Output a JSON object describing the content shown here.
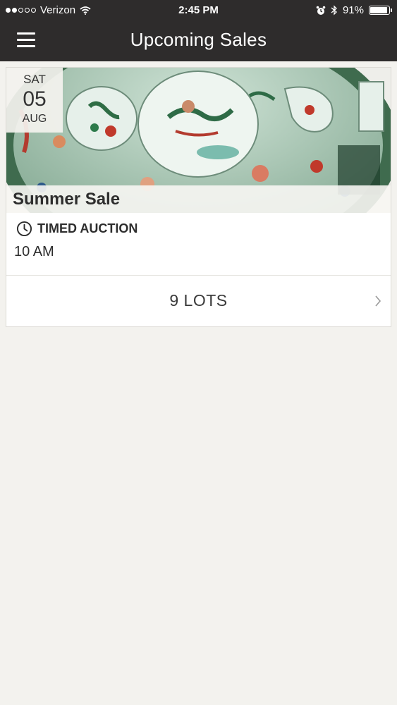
{
  "status": {
    "carrier": "Verizon",
    "time": "2:45 PM",
    "battery": "91%",
    "battery_level": 0.91
  },
  "nav": {
    "title": "Upcoming Sales",
    "menu_icon": "hamburger-menu-icon"
  },
  "sale": {
    "date": {
      "weekday": "SAT",
      "day": "05",
      "month": "AUG"
    },
    "title": "Summer Sale",
    "type": "TIMED AUCTION",
    "type_icon": "clock-icon",
    "time": "10 AM",
    "lots": "9 LOTS",
    "chevron_icon": "chevron-right-icon"
  }
}
